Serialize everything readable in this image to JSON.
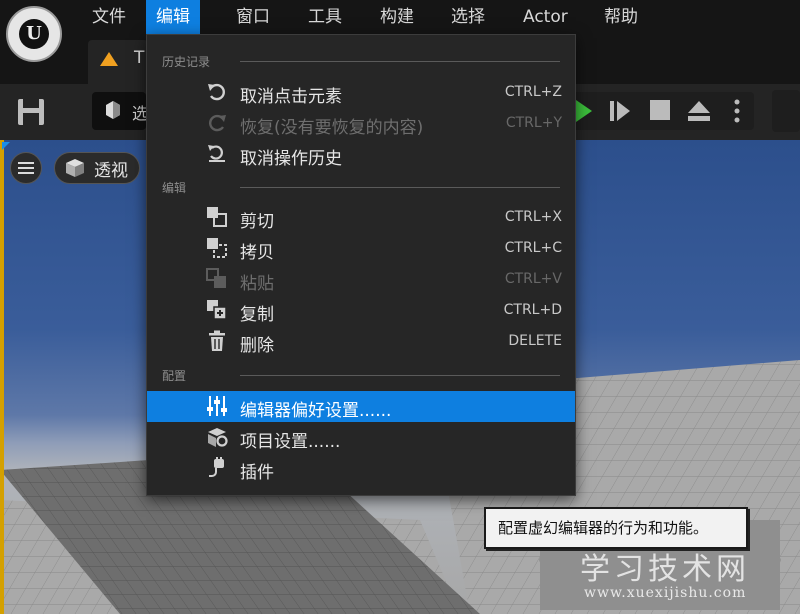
{
  "menubar": {
    "items": [
      "文件",
      "编辑",
      "窗口",
      "工具",
      "构建",
      "选择",
      "Actor",
      "帮助"
    ],
    "active_index": 1
  },
  "tab": {
    "label": "T",
    "icon": "level-warning-icon"
  },
  "toolbar": {
    "select_label": "选"
  },
  "viewport": {
    "perspective_label": "透视"
  },
  "dropdown": {
    "sections": [
      {
        "header": "历史记录",
        "items": [
          {
            "label": "取消点击元素",
            "shortcut": "CTRL+Z",
            "icon": "undo-icon",
            "enabled": true
          },
          {
            "label": "恢复(没有要恢复的内容)",
            "shortcut": "CTRL+Y",
            "icon": "redo-icon",
            "enabled": false
          },
          {
            "label": "取消操作历史",
            "shortcut": "",
            "icon": "undo-history-icon",
            "enabled": true
          }
        ]
      },
      {
        "header": "编辑",
        "items": [
          {
            "label": "剪切",
            "shortcut": "CTRL+X",
            "icon": "cut-icon",
            "enabled": true
          },
          {
            "label": "拷贝",
            "shortcut": "CTRL+C",
            "icon": "copy-icon",
            "enabled": true
          },
          {
            "label": "粘贴",
            "shortcut": "CTRL+V",
            "icon": "paste-icon",
            "enabled": false
          },
          {
            "label": "复制",
            "shortcut": "CTRL+D",
            "icon": "duplicate-icon",
            "enabled": true
          },
          {
            "label": "删除",
            "shortcut": "DELETE",
            "icon": "trash-icon",
            "enabled": true
          }
        ]
      },
      {
        "header": "配置",
        "items": [
          {
            "label": "编辑器偏好设置......",
            "shortcut": "",
            "icon": "sliders-icon",
            "enabled": true,
            "highlighted": true
          },
          {
            "label": "项目设置......",
            "shortcut": "",
            "icon": "project-settings-icon",
            "enabled": true
          },
          {
            "label": "插件",
            "shortcut": "",
            "icon": "plugin-icon",
            "enabled": true
          }
        ]
      }
    ]
  },
  "tooltip": {
    "text": "配置虚幻编辑器的行为和功能。"
  },
  "watermark": {
    "title": "学习技术网",
    "url": "www.xuexijishu.com"
  },
  "colors": {
    "accent": "#0e7fe0",
    "menu_bg": "#262626",
    "play_green": "#3cbf3c",
    "tab_icon": "#f0a020"
  }
}
